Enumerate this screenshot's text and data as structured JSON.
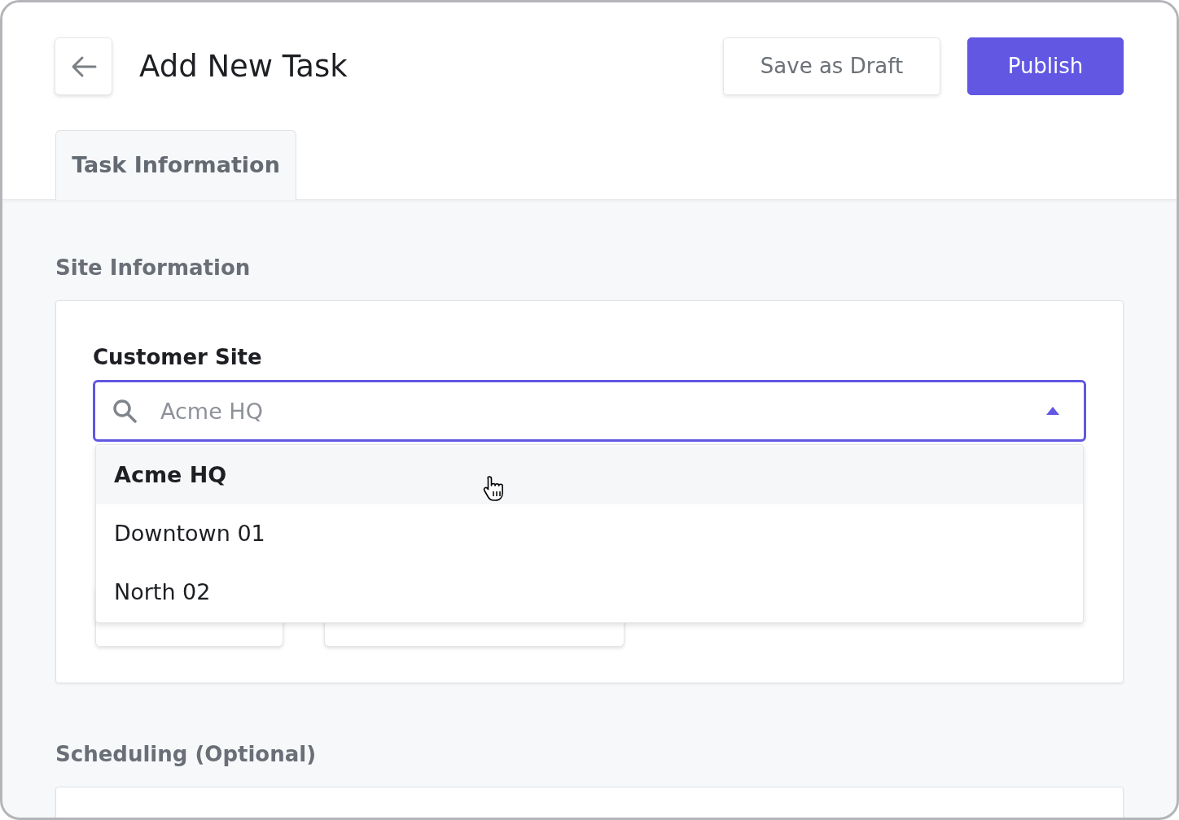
{
  "header": {
    "title": "Add New Task",
    "buttons": [
      {
        "label": "Save as Draft",
        "kind": "secondary"
      },
      {
        "label": "Publish",
        "kind": "primary"
      }
    ]
  },
  "tabs": [
    {
      "label": "Task Information",
      "selected": true
    }
  ],
  "sections": [
    {
      "title": "Site Information",
      "field": {
        "label": "Customer Site",
        "placeholder": "Acme HQ",
        "expanded": true,
        "options": [
          {
            "label": "Acme HQ",
            "selected": true
          },
          {
            "label": "Downtown 01",
            "selected": false
          },
          {
            "label": "North 02",
            "selected": false
          }
        ]
      }
    },
    {
      "title": "Scheduling (Optional)"
    }
  ]
}
